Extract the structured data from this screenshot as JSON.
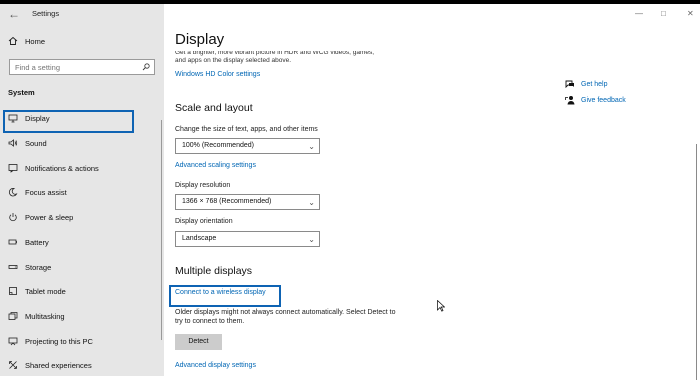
{
  "window": {
    "title": "Settings",
    "back_icon": "back-arrow-icon",
    "controls": [
      "—",
      "□",
      "✕"
    ]
  },
  "sidebar": {
    "home_label": "Home",
    "search_placeholder": "Find a setting",
    "section_label": "System",
    "items": [
      {
        "label": "Display",
        "icon": "monitor-icon",
        "selected": true
      },
      {
        "label": "Sound",
        "icon": "speaker-icon"
      },
      {
        "label": "Notifications & actions",
        "icon": "notifications-icon"
      },
      {
        "label": "Focus assist",
        "icon": "moon-icon"
      },
      {
        "label": "Power & sleep",
        "icon": "power-icon"
      },
      {
        "label": "Battery",
        "icon": "battery-icon"
      },
      {
        "label": "Storage",
        "icon": "storage-icon"
      },
      {
        "label": "Tablet mode",
        "icon": "tablet-icon"
      },
      {
        "label": "Multitasking",
        "icon": "multitasking-icon"
      },
      {
        "label": "Projecting to this PC",
        "icon": "projector-icon"
      },
      {
        "label": "Shared experiences",
        "icon": "shared-icon"
      }
    ]
  },
  "main": {
    "title": "Display",
    "description_line1": "Get a brighter, more vibrant picture in HDR and WCG videos, games,",
    "description_line2": "and apps on the display selected above.",
    "hd_color_link": "Windows HD Color settings",
    "scale_heading": "Scale and layout",
    "scale_label": "Change the size of text, apps, and other items",
    "scale_value": "100% (Recommended)",
    "advanced_scaling_link": "Advanced scaling settings",
    "resolution_label": "Display resolution",
    "resolution_value": "1366 × 768 (Recommended)",
    "orientation_label": "Display orientation",
    "orientation_value": "Landscape",
    "multiple_heading": "Multiple displays",
    "wireless_link": "Connect to a wireless display",
    "older_text_line1": "Older displays might not always connect automatically. Select Detect to",
    "older_text_line2": "try to connect to them.",
    "detect_label": "Detect",
    "advanced_display_link": "Advanced display settings"
  },
  "help": {
    "get_help": "Get help",
    "give_feedback": "Give feedback"
  },
  "colors": {
    "accent": "#0066b4",
    "highlight_border": "#0e63b3",
    "sidebar_bg": "#e6e6e6"
  }
}
